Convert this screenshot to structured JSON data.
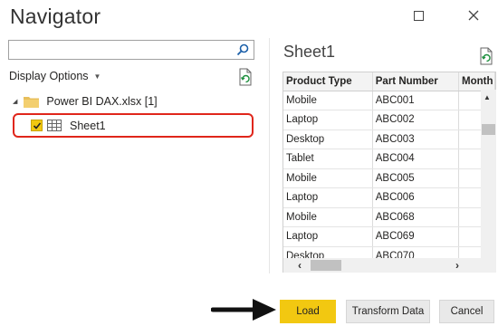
{
  "window": {
    "title": "Navigator",
    "maximize_icon": "maximize-icon",
    "close_icon": "close-icon"
  },
  "left_pane": {
    "search": {
      "value": "",
      "placeholder": ""
    },
    "display_options_label": "Display Options",
    "tree": {
      "file_label": "Power BI DAX.xlsx [1]",
      "items": [
        {
          "label": "Sheet1",
          "checked": true,
          "highlight_color": "#e0261b"
        }
      ]
    }
  },
  "preview": {
    "title": "Sheet1",
    "columns": [
      "Product Type",
      "Part Number",
      "Month"
    ],
    "rows": [
      [
        "Mobile",
        "ABC001",
        ""
      ],
      [
        "Laptop",
        "ABC002",
        ""
      ],
      [
        "Desktop",
        "ABC003",
        ""
      ],
      [
        "Tablet",
        "ABC004",
        ""
      ],
      [
        "Mobile",
        "ABC005",
        ""
      ],
      [
        "Laptop",
        "ABC006",
        ""
      ],
      [
        "Mobile",
        "ABC068",
        ""
      ],
      [
        "Laptop",
        "ABC069",
        ""
      ],
      [
        "Desktop",
        "ABC070",
        ""
      ]
    ]
  },
  "footer": {
    "load_label": "Load",
    "transform_label": "Transform Data",
    "cancel_label": "Cancel"
  },
  "colors": {
    "accent_yellow": "#f2c811",
    "highlight_red": "#e0261b"
  }
}
